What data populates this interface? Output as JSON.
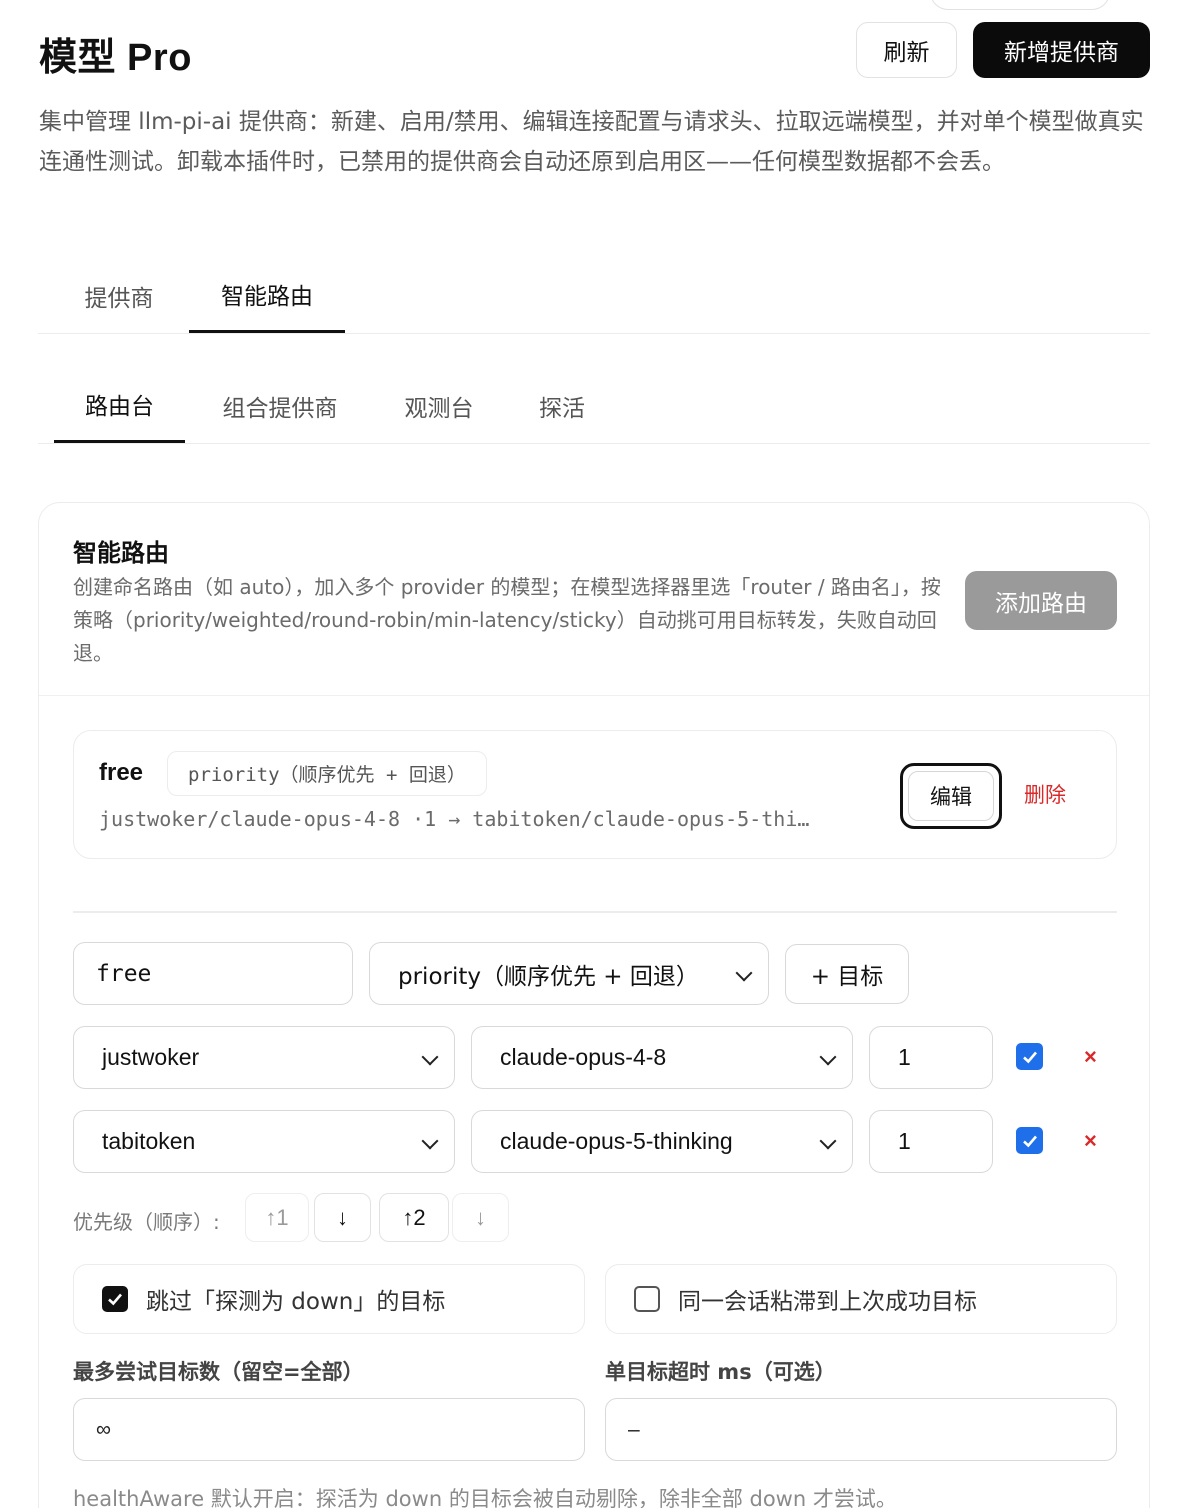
{
  "header": {
    "title": "模型 Pro",
    "refresh_label": "刷新",
    "add_provider_label": "新增提供商",
    "description": "集中管理 llm-pi-ai 提供商：新建、启用/禁用、编辑连接配置与请求头、拉取远端模型，并对单个模型做真实连通性测试。卸载本插件时，已禁用的提供商会自动还原到启用区——任何模型数据都不会丢。"
  },
  "main_tabs": [
    {
      "label": "提供商",
      "active": false
    },
    {
      "label": "智能路由",
      "active": true
    }
  ],
  "sub_tabs": [
    {
      "label": "路由台",
      "active": true
    },
    {
      "label": "组合提供商",
      "active": false
    },
    {
      "label": "观测台",
      "active": false
    },
    {
      "label": "探活",
      "active": false
    }
  ],
  "router_card": {
    "title": "智能路由",
    "description": "创建命名路由（如 auto），加入多个 provider 的模型；在模型选择器里选「router / 路由名」，按策略（priority/weighted/round-robin/min-latency/sticky）自动挑可用目标转发，失败自动回退。",
    "add_route_label": "添加路由",
    "route": {
      "name": "free",
      "strategy_badge": "priority（顺序优先 + 回退）",
      "targets_summary": "justwoker/claude-opus-4-8 ·1 → tabitoken/claude-opus-5-thi…",
      "edit_label": "编辑",
      "delete_label": "删除"
    },
    "editor": {
      "name_value": "free",
      "strategy_value": "priority（顺序优先 + 回退）",
      "add_target_label": "+ 目标",
      "targets": [
        {
          "provider": "justwoker",
          "model": "claude-opus-4-8",
          "weight": "1",
          "enabled": true,
          "remove": "×"
        },
        {
          "provider": "tabitoken",
          "model": "claude-opus-5-thinking",
          "weight": "1",
          "enabled": true,
          "remove": "×"
        }
      ],
      "priority_label": "优先级（顺序）:",
      "priority_buttons": [
        "↑1",
        "↓",
        "↑2",
        "↓"
      ],
      "skip_down_label": "跳过「探测为 down」的目标",
      "skip_down_checked": true,
      "sticky_label": "同一会话粘滞到上次成功目标",
      "sticky_checked": false,
      "max_attempts_label": "最多尝试目标数（留空=全部）",
      "max_attempts_value": "∞",
      "timeout_label": "单目标超时 ms（可选）",
      "timeout_value": "–",
      "footnote": "healthAware 默认开启：探活为 down 的目标会被自动剔除，除非全部 down 才尝试。"
    }
  },
  "colors": {
    "accent": "#1f6feb",
    "danger": "#d92a2a",
    "primary_button": "#0b0b0b",
    "disabled_button": "#9a9a9a"
  }
}
